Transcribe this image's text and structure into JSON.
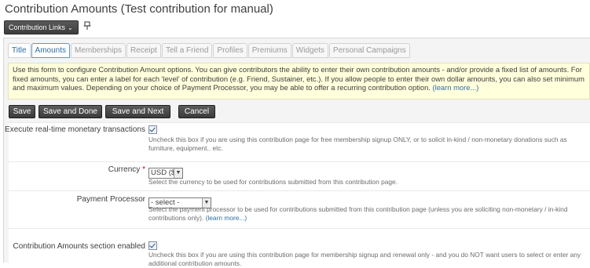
{
  "page": {
    "title": "Contribution Amounts (Test contribution for manual)"
  },
  "toolbar": {
    "links_label": "Contribution Links",
    "links_icon": "chevron-down-icon",
    "pin_icon": "pin-icon"
  },
  "tabs": [
    {
      "label": "Title"
    },
    {
      "label": "Amounts",
      "active": true
    },
    {
      "label": "Memberships"
    },
    {
      "label": "Receipt"
    },
    {
      "label": "Tell a Friend"
    },
    {
      "label": "Profiles"
    },
    {
      "label": "Premiums"
    },
    {
      "label": "Widgets"
    },
    {
      "label": "Personal Campaigns"
    }
  ],
  "info": {
    "text": "Use this form to configure Contribution Amount options. You can give contributors the ability to enter their own contribution amounts - and/or provide a fixed list of amounts. For fixed amounts, you can enter a label for each 'level' of contribution (e.g. Friend, Sustainer, etc.). If you allow people to enter their own dollar amounts, you can also set minimum and maximum values. Depending on your choice of Payment Processor, you may be able to offer a recurring contribution option.",
    "learn_more": "(learn more...)"
  },
  "buttons": {
    "save": "Save",
    "save_done": "Save and Done",
    "save_next": "Save and Next",
    "cancel": "Cancel"
  },
  "form": {
    "monetary": {
      "label": "Execute real-time monetary transactions",
      "checked": true,
      "help": "Uncheck this box if you are using this contribution page for free membership signup ONLY, or to solicit in-kind / non-monetary donations such as furniture, equipment.. etc."
    },
    "currency": {
      "label": "Currency",
      "required_mark": "*",
      "value": "USD ($)",
      "help": "Select the currency to be used for contributions submitted from this contribution page."
    },
    "processor": {
      "label": "Payment Processor",
      "value": "- select -",
      "help": "Select the payment processor to be used for contributions submitted from this contribution page (unless you are soliciting non-monetary / in-kind contributions only).",
      "learn_more": "(learn more...)"
    },
    "amounts_enabled": {
      "label": "Contribution Amounts section enabled",
      "checked": true,
      "help": "Uncheck this box if you are using this contribution page for membership signup and renewal only - and you do NOT want users to select or enter any additional contribution amounts."
    }
  },
  "colors": {
    "accent": "#2d6ea8",
    "info_bg": "#ffffdc",
    "button_bg": "#4a4a4a",
    "required": "#cc0000"
  }
}
